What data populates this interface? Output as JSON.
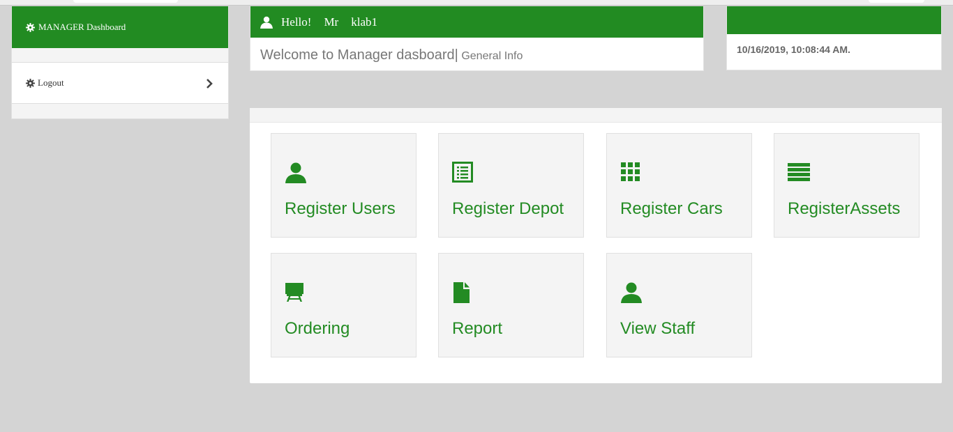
{
  "sidebar": {
    "title": "MANAGER Dashboard",
    "items": [
      {
        "label": "Logout",
        "icon": "gear-icon"
      }
    ]
  },
  "greeting": {
    "hello": "Hello!",
    "prefix": "Mr",
    "username": "klab1",
    "welcome": "Welcome to Manager dasboard|",
    "info": "General Info"
  },
  "datetime": "10/16/2019, 10:08:44 AM.",
  "tiles": [
    {
      "label": "Register Users",
      "icon": "user-icon"
    },
    {
      "label": "Register Depot",
      "icon": "list-icon"
    },
    {
      "label": "Register Cars",
      "icon": "grid-icon"
    },
    {
      "label": "RegisterAssets",
      "icon": "bars-icon"
    },
    {
      "label": "Ordering",
      "icon": "easel-icon"
    },
    {
      "label": "Report",
      "icon": "file-icon"
    },
    {
      "label": "View Staff",
      "icon": "user-icon"
    }
  ],
  "colors": {
    "brand": "#228b22",
    "background": "#d4d4d4",
    "tile": "#f4f4f4"
  }
}
